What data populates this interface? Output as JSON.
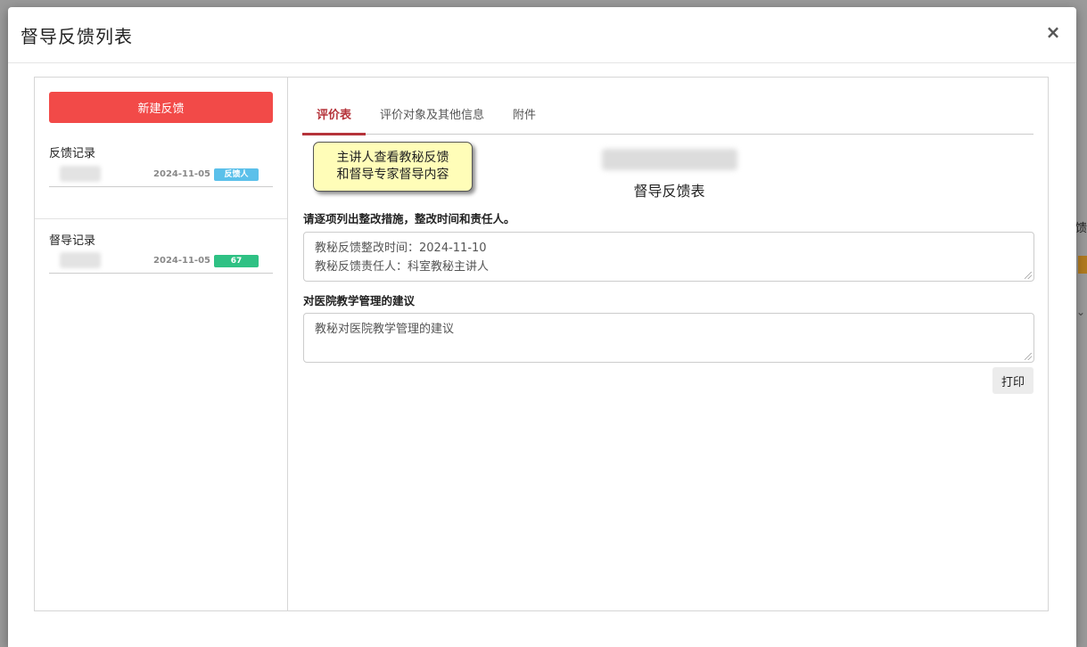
{
  "background": {
    "right_text": "反馈"
  },
  "modal": {
    "title": "督导反馈列表",
    "close_label": "×"
  },
  "left": {
    "new_button": "新建反馈",
    "feedback_section": "反馈记录",
    "feedback_record": {
      "date": "2024-11-05",
      "badge": "反馈人",
      "badge_color": "#5bc0ea"
    },
    "supervision_section": "督导记录",
    "supervision_record": {
      "date": "2024-11-05",
      "badge": "67",
      "badge_color": "#2fc184"
    }
  },
  "tabs": [
    {
      "label": "评价表",
      "active": true
    },
    {
      "label": "评价对象及其他信息",
      "active": false
    },
    {
      "label": "附件",
      "active": false
    }
  ],
  "note": {
    "line1": "主讲人查看教秘反馈",
    "line2": "和督导专家督导内容"
  },
  "form": {
    "title": "督导反馈表",
    "q1_label": "请逐项列出整改措施，整改时间和责任人。",
    "q1_line1": "教秘反馈整改时间：2024-11-10",
    "q1_line2": "教秘反馈责任人：科室教秘主讲人",
    "q2_label": "对医院教学管理的建议",
    "q2_text": "教秘对医院教学管理的建议",
    "print_button": "打印"
  },
  "colors": {
    "accent": "#b5333a",
    "primary_button": "#f24a48"
  }
}
